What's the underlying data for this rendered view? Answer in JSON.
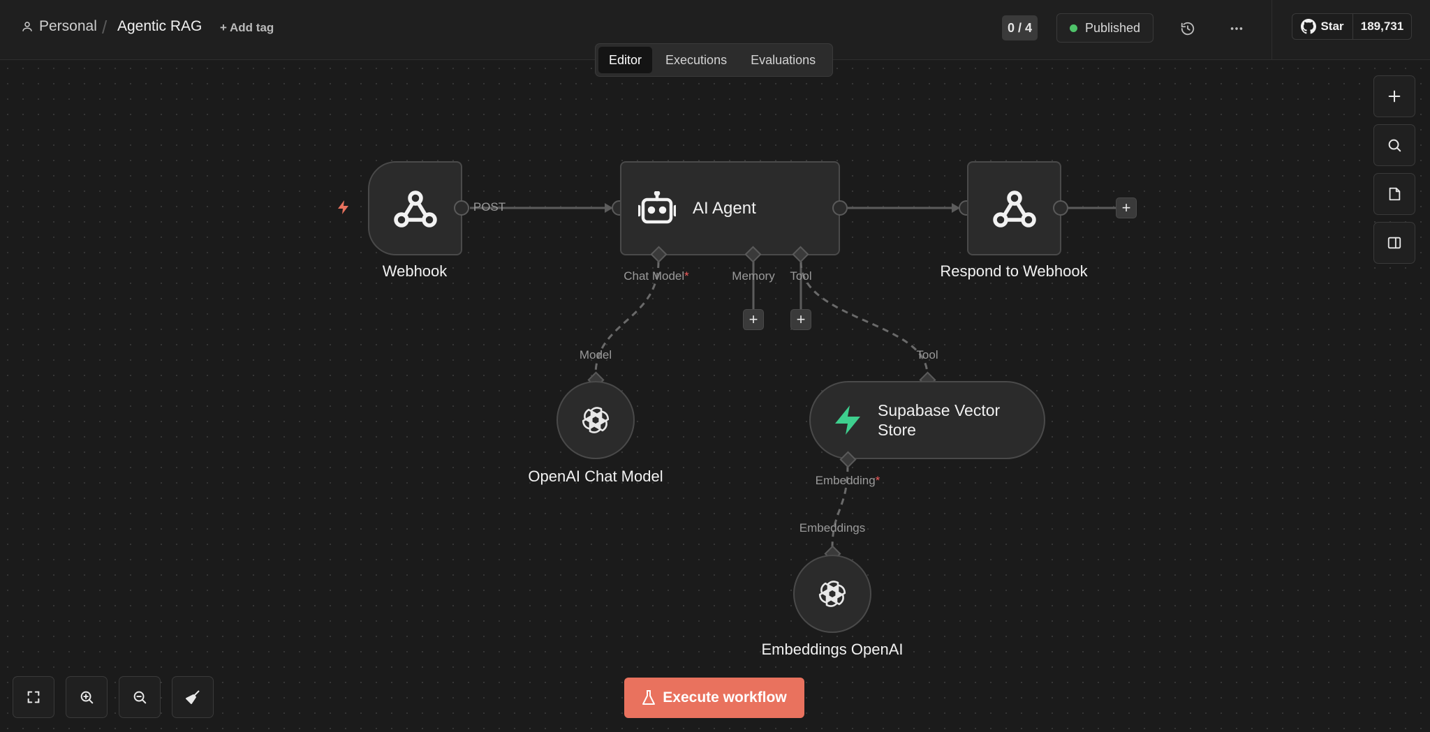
{
  "breadcrumb": {
    "project": "Personal",
    "separator": "/",
    "workflow": "Agentic RAG",
    "add_tag": "+ Add tag"
  },
  "header": {
    "counter": "0 / 4",
    "status": "Published",
    "status_color": "#4fc36a",
    "github": {
      "star_label": "Star",
      "star_count": "189,731"
    }
  },
  "tabs": [
    {
      "label": "Editor",
      "active": true
    },
    {
      "label": "Executions",
      "active": false
    },
    {
      "label": "Evaluations",
      "active": false
    }
  ],
  "nodes": {
    "webhook": {
      "label": "Webhook",
      "output_label": "POST",
      "icon": "webhook-icon"
    },
    "agent": {
      "label": "AI Agent",
      "icon": "robot-icon",
      "ports": {
        "chat_model": "Chat Model",
        "memory": "Memory",
        "tool": "Tool"
      }
    },
    "respond": {
      "label": "Respond to Webhook",
      "icon": "webhook-icon"
    },
    "openai_chat": {
      "label": "OpenAI Chat Model",
      "port": "Model",
      "icon": "openai-icon"
    },
    "supabase": {
      "label": "Supabase Vector Store",
      "port_top": "Tool",
      "port_bottom": "Embedding",
      "icon": "supabase-icon",
      "icon_color": "#3ecf8e"
    },
    "embeddings": {
      "label": "Embeddings OpenAI",
      "port": "Embeddings",
      "icon": "openai-icon"
    }
  },
  "required_mark": "*",
  "actions": {
    "execute": "Execute workflow",
    "execute_color": "#e9725e",
    "trigger_color": "#e9725e"
  }
}
